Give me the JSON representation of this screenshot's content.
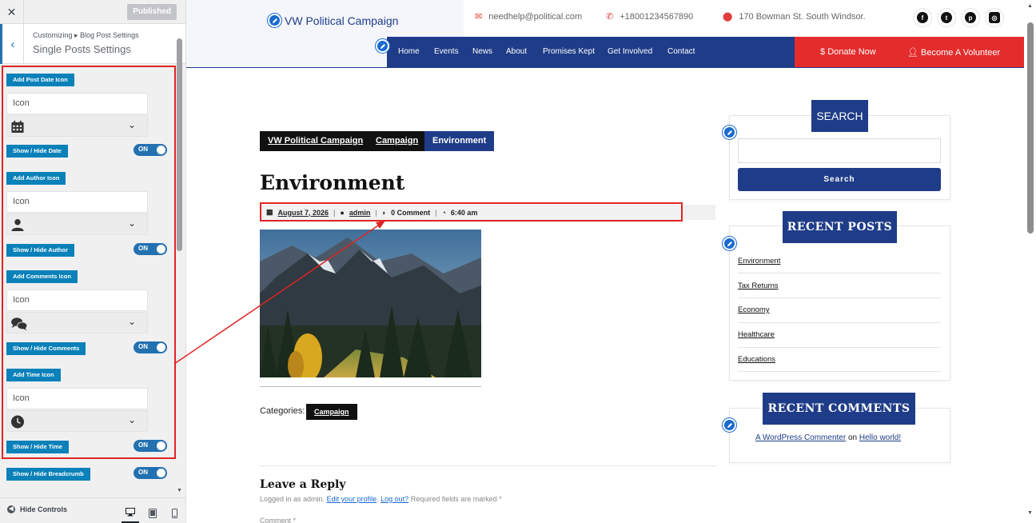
{
  "customizer": {
    "close_icon": "close-icon",
    "published_label": "Published",
    "breadcrumb": "Customizing ▸ Blog Post Settings",
    "section_title": "Single Posts Settings",
    "controls": [
      {
        "label": "Add Post Date Icon",
        "input_placeholder": "Icon",
        "icon": "calendar-icon",
        "toggle_label": "Show / Hide Date",
        "toggle_state": "ON"
      },
      {
        "label": "Add Author Icon",
        "input_placeholder": "Icon",
        "icon": "user-icon",
        "toggle_label": "Show / Hide Author",
        "toggle_state": "ON"
      },
      {
        "label": "Add Comments Icon",
        "input_placeholder": "Icon",
        "icon": "comments-icon",
        "toggle_label": "Show / Hide Comments",
        "toggle_state": "ON"
      },
      {
        "label": "Add Time Icon",
        "input_placeholder": "Icon",
        "icon": "clock-icon",
        "toggle_label": "Show / Hide Time",
        "toggle_state": "ON"
      }
    ],
    "breadcrumb_toggle": {
      "label": "Show / Hide Breadcrumb",
      "state": "ON"
    },
    "hide_controls_label": "Hide Controls",
    "devices": [
      "desktop-icon",
      "tablet-icon",
      "mobile-icon"
    ]
  },
  "site": {
    "brand": "VW Political Campaign",
    "contacts": {
      "email": "needhelp@political.com",
      "phone": "+18001234567890",
      "address": "170 Bowman St. South Windsor."
    },
    "social": [
      "facebook-icon",
      "twitter-icon",
      "pinterest-icon",
      "instagram-icon"
    ],
    "nav": [
      "Home",
      "Events",
      "News",
      "About",
      "Promises Kept",
      "Get Involved",
      "Contact"
    ],
    "donate_label": "Donate Now",
    "volunteer_label": "Become A Volunteer",
    "colors": {
      "primary": "#1f3c88",
      "accent": "#e42c2c"
    }
  },
  "post": {
    "tags": [
      "VW Political Campaign",
      "Campaign",
      "Environment"
    ],
    "title": "Environment",
    "meta": {
      "date": "August 7, 2026",
      "author": "admin",
      "comments": "0 Comment",
      "time": "6:40 am",
      "separator": "|"
    },
    "categories_label": "Categories:",
    "category": "Campaign",
    "reply_title": "Leave a Reply",
    "logged_prefix": "Logged in as admin.",
    "edit_profile": "Edit your profile",
    "logout": "Log out?",
    "required_note": "Required fields are marked *",
    "comment_label": "Comment *"
  },
  "sidebar": {
    "search_title": "SEARCH",
    "search_button": "Search",
    "recent_posts_title": "RECENT POSTS",
    "recent_posts": [
      "Environment",
      "Tax Returns",
      "Economy",
      "Healthcare",
      "Educations"
    ],
    "recent_comments_title": "RECENT COMMENTS",
    "recent_comment": {
      "author": "A WordPress Commenter",
      "on": "on",
      "post": "Hello world!"
    }
  }
}
